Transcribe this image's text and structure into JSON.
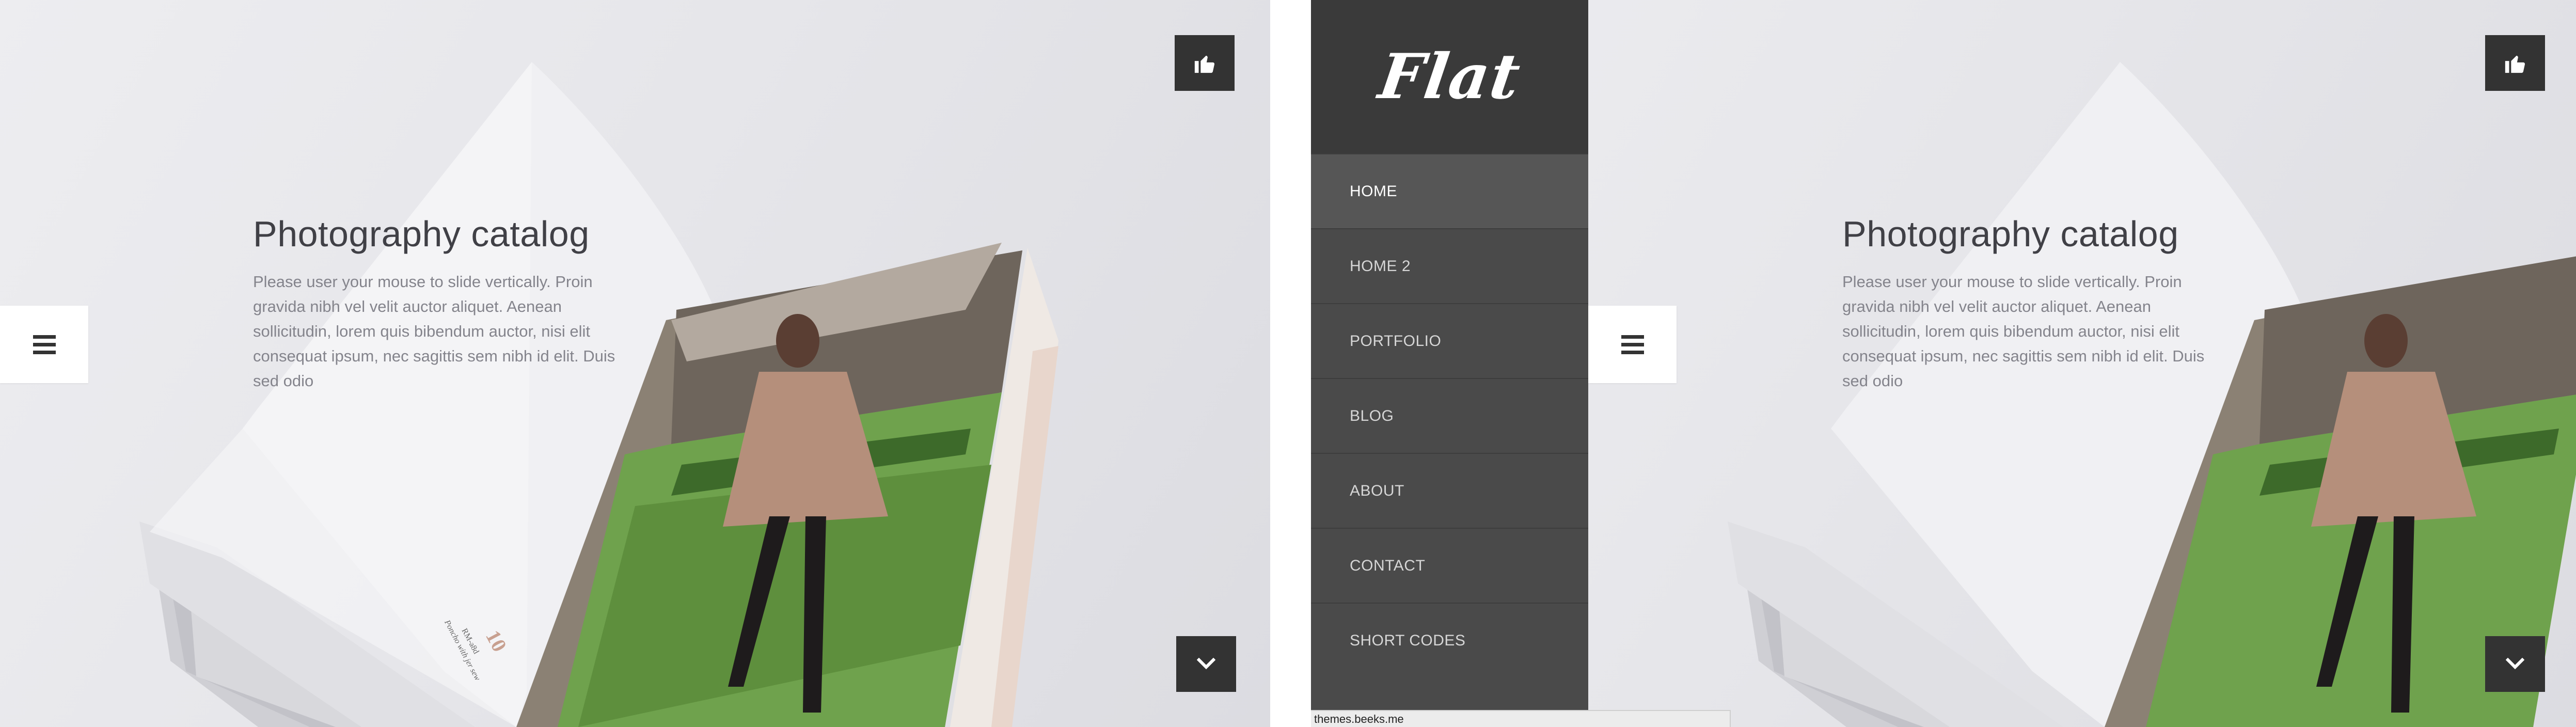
{
  "hero": {
    "title": "Photography catalog",
    "text": "Please user your mouse to slide vertically. Proin gravida nibh vel velit auctor aliquet. Aenean sollicitudin, lorem quis bibendum auctor, nisi elit consequat ipsum, nec sagittis sem nibh id elit. Duis sed odio"
  },
  "catalog_page": {
    "page_number": "10",
    "caption_line1": "RM-a8d",
    "caption_line2": "Poncho with jer sew"
  },
  "icons": {
    "menu": "hamburger-menu-icon",
    "like": "thumbs-up-icon",
    "scroll_down": "chevron-down-icon"
  },
  "sidebar": {
    "logo": "Flat",
    "items": [
      {
        "label": "HOME"
      },
      {
        "label": "HOME 2"
      },
      {
        "label": "PORTFOLIO"
      },
      {
        "label": "BLOG"
      },
      {
        "label": "ABOUT"
      },
      {
        "label": "CONTACT"
      },
      {
        "label": "SHORT CODES"
      }
    ]
  },
  "status_bar": {
    "url": "themes.beeks.me"
  },
  "colors": {
    "button_dark": "#333333",
    "sidebar_bg": "#4a4a4a",
    "sidebar_logo_bg": "#3a3a3a",
    "sidebar_active": "#565656",
    "title_text": "#404046",
    "body_text": "#84848c"
  }
}
